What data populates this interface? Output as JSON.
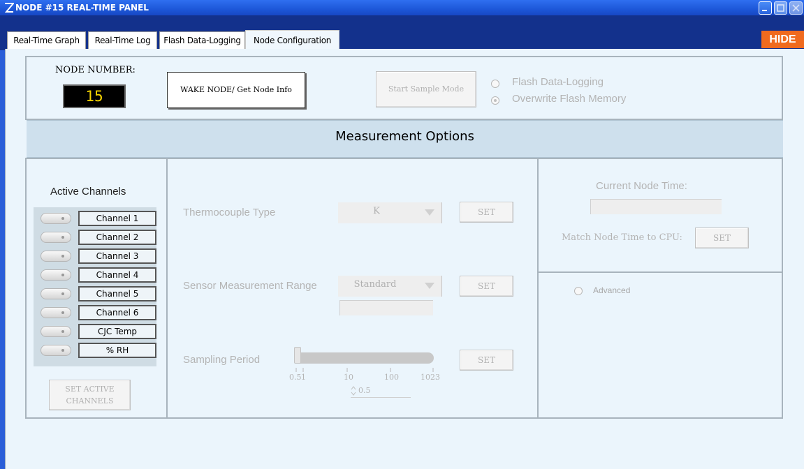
{
  "window": {
    "title": "NODE #15 REAL-TIME PANEL",
    "hide_label": "HIDE"
  },
  "tabs": [
    {
      "label": "Real-Time Graph"
    },
    {
      "label": "Real-Time Log"
    },
    {
      "label": "Flash Data-Logging"
    },
    {
      "label": "Node Configuration"
    }
  ],
  "node": {
    "number_label": "NODE NUMBER:",
    "number_value": "15",
    "wake_label": "WAKE NODE/ Get Node Info",
    "start_sample_label": "Start Sample Mode",
    "option_flash": "Flash Data-Logging",
    "option_overwrite": "Overwrite Flash Memory"
  },
  "measurement": {
    "title": "Measurement Options"
  },
  "channels": {
    "title": "Active Channels",
    "items": [
      "Channel 1",
      "Channel 2",
      "Channel 3",
      "Channel 4",
      "Channel 5",
      "Channel 6",
      "CJC Temp",
      "% RH"
    ],
    "set_label_line1": "SET ACTIVE",
    "set_label_line2": "CHANNELS"
  },
  "settings": {
    "thermocouple_label": "Thermocouple Type",
    "thermocouple_value": "K",
    "range_label": "Sensor Measurement Range",
    "range_value": "Standard",
    "sampling_label": "Sampling Period",
    "sampling_ticks": [
      "0.5",
      "1",
      "10",
      "100",
      "1023"
    ],
    "sampling_value": "0.5",
    "set_label": "SET"
  },
  "time": {
    "current_label": "Current Node Time:",
    "match_label": "Match Node Time to CPU:",
    "set_label": "SET",
    "advanced_label": "Advanced"
  },
  "colors": {
    "accent_orange": "#f06a1e",
    "display_text": "#f5d400",
    "panel_bg": "#ebf5fc"
  }
}
